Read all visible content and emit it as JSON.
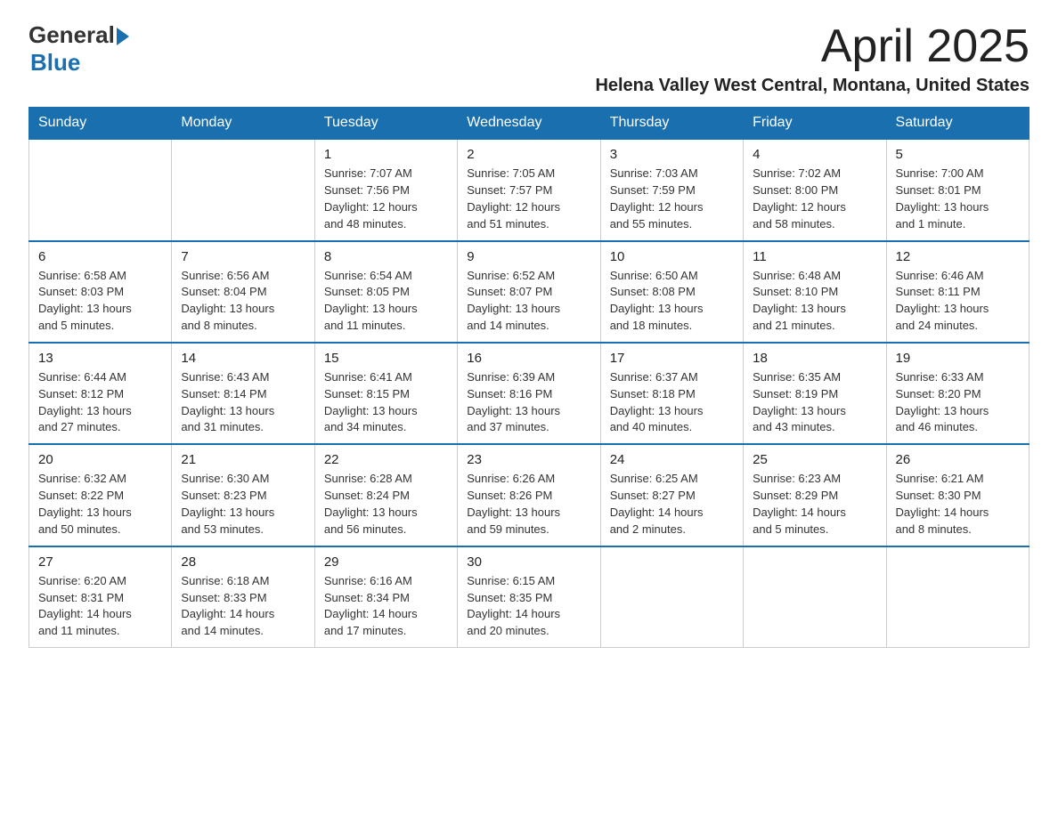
{
  "logo": {
    "general": "General",
    "blue": "Blue"
  },
  "title": {
    "month_year": "April 2025",
    "location": "Helena Valley West Central, Montana, United States"
  },
  "days_of_week": [
    "Sunday",
    "Monday",
    "Tuesday",
    "Wednesday",
    "Thursday",
    "Friday",
    "Saturday"
  ],
  "weeks": [
    [
      {
        "day": "",
        "info": ""
      },
      {
        "day": "",
        "info": ""
      },
      {
        "day": "1",
        "info": "Sunrise: 7:07 AM\nSunset: 7:56 PM\nDaylight: 12 hours\nand 48 minutes."
      },
      {
        "day": "2",
        "info": "Sunrise: 7:05 AM\nSunset: 7:57 PM\nDaylight: 12 hours\nand 51 minutes."
      },
      {
        "day": "3",
        "info": "Sunrise: 7:03 AM\nSunset: 7:59 PM\nDaylight: 12 hours\nand 55 minutes."
      },
      {
        "day": "4",
        "info": "Sunrise: 7:02 AM\nSunset: 8:00 PM\nDaylight: 12 hours\nand 58 minutes."
      },
      {
        "day": "5",
        "info": "Sunrise: 7:00 AM\nSunset: 8:01 PM\nDaylight: 13 hours\nand 1 minute."
      }
    ],
    [
      {
        "day": "6",
        "info": "Sunrise: 6:58 AM\nSunset: 8:03 PM\nDaylight: 13 hours\nand 5 minutes."
      },
      {
        "day": "7",
        "info": "Sunrise: 6:56 AM\nSunset: 8:04 PM\nDaylight: 13 hours\nand 8 minutes."
      },
      {
        "day": "8",
        "info": "Sunrise: 6:54 AM\nSunset: 8:05 PM\nDaylight: 13 hours\nand 11 minutes."
      },
      {
        "day": "9",
        "info": "Sunrise: 6:52 AM\nSunset: 8:07 PM\nDaylight: 13 hours\nand 14 minutes."
      },
      {
        "day": "10",
        "info": "Sunrise: 6:50 AM\nSunset: 8:08 PM\nDaylight: 13 hours\nand 18 minutes."
      },
      {
        "day": "11",
        "info": "Sunrise: 6:48 AM\nSunset: 8:10 PM\nDaylight: 13 hours\nand 21 minutes."
      },
      {
        "day": "12",
        "info": "Sunrise: 6:46 AM\nSunset: 8:11 PM\nDaylight: 13 hours\nand 24 minutes."
      }
    ],
    [
      {
        "day": "13",
        "info": "Sunrise: 6:44 AM\nSunset: 8:12 PM\nDaylight: 13 hours\nand 27 minutes."
      },
      {
        "day": "14",
        "info": "Sunrise: 6:43 AM\nSunset: 8:14 PM\nDaylight: 13 hours\nand 31 minutes."
      },
      {
        "day": "15",
        "info": "Sunrise: 6:41 AM\nSunset: 8:15 PM\nDaylight: 13 hours\nand 34 minutes."
      },
      {
        "day": "16",
        "info": "Sunrise: 6:39 AM\nSunset: 8:16 PM\nDaylight: 13 hours\nand 37 minutes."
      },
      {
        "day": "17",
        "info": "Sunrise: 6:37 AM\nSunset: 8:18 PM\nDaylight: 13 hours\nand 40 minutes."
      },
      {
        "day": "18",
        "info": "Sunrise: 6:35 AM\nSunset: 8:19 PM\nDaylight: 13 hours\nand 43 minutes."
      },
      {
        "day": "19",
        "info": "Sunrise: 6:33 AM\nSunset: 8:20 PM\nDaylight: 13 hours\nand 46 minutes."
      }
    ],
    [
      {
        "day": "20",
        "info": "Sunrise: 6:32 AM\nSunset: 8:22 PM\nDaylight: 13 hours\nand 50 minutes."
      },
      {
        "day": "21",
        "info": "Sunrise: 6:30 AM\nSunset: 8:23 PM\nDaylight: 13 hours\nand 53 minutes."
      },
      {
        "day": "22",
        "info": "Sunrise: 6:28 AM\nSunset: 8:24 PM\nDaylight: 13 hours\nand 56 minutes."
      },
      {
        "day": "23",
        "info": "Sunrise: 6:26 AM\nSunset: 8:26 PM\nDaylight: 13 hours\nand 59 minutes."
      },
      {
        "day": "24",
        "info": "Sunrise: 6:25 AM\nSunset: 8:27 PM\nDaylight: 14 hours\nand 2 minutes."
      },
      {
        "day": "25",
        "info": "Sunrise: 6:23 AM\nSunset: 8:29 PM\nDaylight: 14 hours\nand 5 minutes."
      },
      {
        "day": "26",
        "info": "Sunrise: 6:21 AM\nSunset: 8:30 PM\nDaylight: 14 hours\nand 8 minutes."
      }
    ],
    [
      {
        "day": "27",
        "info": "Sunrise: 6:20 AM\nSunset: 8:31 PM\nDaylight: 14 hours\nand 11 minutes."
      },
      {
        "day": "28",
        "info": "Sunrise: 6:18 AM\nSunset: 8:33 PM\nDaylight: 14 hours\nand 14 minutes."
      },
      {
        "day": "29",
        "info": "Sunrise: 6:16 AM\nSunset: 8:34 PM\nDaylight: 14 hours\nand 17 minutes."
      },
      {
        "day": "30",
        "info": "Sunrise: 6:15 AM\nSunset: 8:35 PM\nDaylight: 14 hours\nand 20 minutes."
      },
      {
        "day": "",
        "info": ""
      },
      {
        "day": "",
        "info": ""
      },
      {
        "day": "",
        "info": ""
      }
    ]
  ]
}
